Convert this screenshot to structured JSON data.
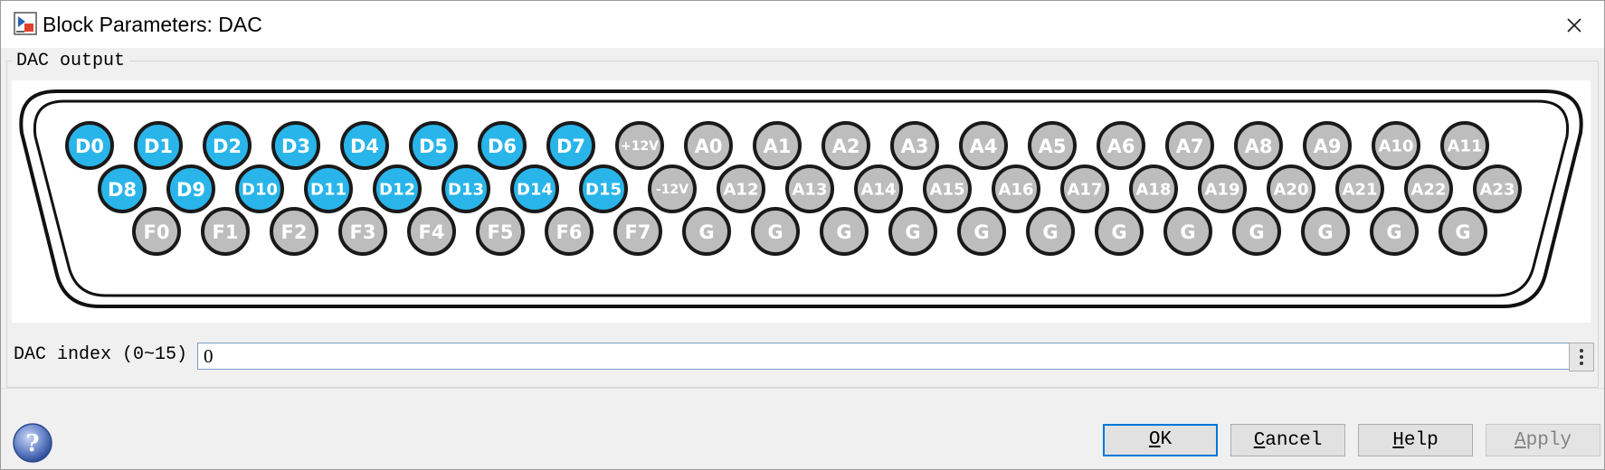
{
  "window": {
    "title": "Block Parameters: DAC",
    "icons": {
      "app": "simulink-block-icon",
      "close": "close-icon"
    }
  },
  "group": {
    "label": "DAC output"
  },
  "connector": {
    "colors": {
      "active": "#29b5ea",
      "inactive": "#bdbdbd",
      "outline": "#1a1a1a"
    },
    "rows": [
      {
        "pins": [
          {
            "label": "D0",
            "active": true
          },
          {
            "label": "D1",
            "active": true
          },
          {
            "label": "D2",
            "active": true
          },
          {
            "label": "D3",
            "active": true
          },
          {
            "label": "D4",
            "active": true
          },
          {
            "label": "D5",
            "active": true
          },
          {
            "label": "D6",
            "active": true
          },
          {
            "label": "D7",
            "active": true
          },
          {
            "label": "+12V",
            "active": false
          },
          {
            "label": "A0",
            "active": false
          },
          {
            "label": "A1",
            "active": false
          },
          {
            "label": "A2",
            "active": false
          },
          {
            "label": "A3",
            "active": false
          },
          {
            "label": "A4",
            "active": false
          },
          {
            "label": "A5",
            "active": false
          },
          {
            "label": "A6",
            "active": false
          },
          {
            "label": "A7",
            "active": false
          },
          {
            "label": "A8",
            "active": false
          },
          {
            "label": "A9",
            "active": false
          },
          {
            "label": "A10",
            "active": false
          },
          {
            "label": "A11",
            "active": false
          }
        ]
      },
      {
        "pins": [
          {
            "label": "D8",
            "active": true
          },
          {
            "label": "D9",
            "active": true
          },
          {
            "label": "D10",
            "active": true
          },
          {
            "label": "D11",
            "active": true
          },
          {
            "label": "D12",
            "active": true
          },
          {
            "label": "D13",
            "active": true
          },
          {
            "label": "D14",
            "active": true
          },
          {
            "label": "D15",
            "active": true
          },
          {
            "label": "-12V",
            "active": false
          },
          {
            "label": "A12",
            "active": false
          },
          {
            "label": "A13",
            "active": false
          },
          {
            "label": "A14",
            "active": false
          },
          {
            "label": "A15",
            "active": false
          },
          {
            "label": "A16",
            "active": false
          },
          {
            "label": "A17",
            "active": false
          },
          {
            "label": "A18",
            "active": false
          },
          {
            "label": "A19",
            "active": false
          },
          {
            "label": "A20",
            "active": false
          },
          {
            "label": "A21",
            "active": false
          },
          {
            "label": "A22",
            "active": false
          },
          {
            "label": "A23",
            "active": false
          }
        ]
      },
      {
        "pins": [
          {
            "label": "F0",
            "active": false
          },
          {
            "label": "F1",
            "active": false
          },
          {
            "label": "F2",
            "active": false
          },
          {
            "label": "F3",
            "active": false
          },
          {
            "label": "F4",
            "active": false
          },
          {
            "label": "F5",
            "active": false
          },
          {
            "label": "F6",
            "active": false
          },
          {
            "label": "F7",
            "active": false
          },
          {
            "label": "G",
            "active": false
          },
          {
            "label": "G",
            "active": false
          },
          {
            "label": "G",
            "active": false
          },
          {
            "label": "G",
            "active": false
          },
          {
            "label": "G",
            "active": false
          },
          {
            "label": "G",
            "active": false
          },
          {
            "label": "G",
            "active": false
          },
          {
            "label": "G",
            "active": false
          },
          {
            "label": "G",
            "active": false
          },
          {
            "label": "G",
            "active": false
          },
          {
            "label": "G",
            "active": false
          },
          {
            "label": "G",
            "active": false
          }
        ]
      }
    ]
  },
  "dac_index": {
    "label": "DAC index (0~15)",
    "value": "0",
    "more_icon": "vertical-ellipsis-icon"
  },
  "footer": {
    "help_icon": "help-question-icon",
    "buttons": {
      "ok": {
        "mnemonic": "O",
        "rest": "K"
      },
      "cancel": {
        "mnemonic": "C",
        "rest": "ancel"
      },
      "help": {
        "mnemonic": "H",
        "rest": "elp"
      },
      "apply": {
        "mnemonic": "A",
        "rest": "pply",
        "disabled": true
      }
    }
  }
}
